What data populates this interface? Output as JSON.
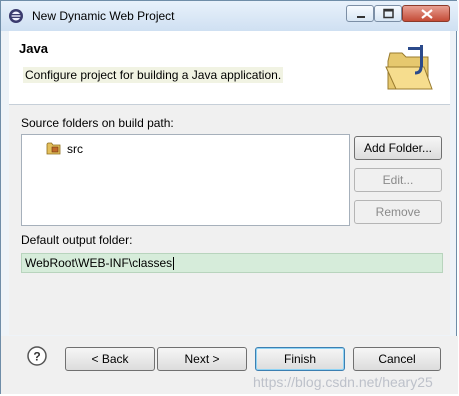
{
  "window": {
    "title": "New Dynamic Web Project"
  },
  "banner": {
    "title": "Java",
    "description": "Configure project for building a Java application."
  },
  "source_folders": {
    "label": "Source folders on build path:",
    "items": [
      {
        "label": "src"
      }
    ]
  },
  "buttons": {
    "add_folder": "Add Folder...",
    "edit": "Edit...",
    "remove": "Remove",
    "back": "< Back",
    "next": "Next >",
    "finish": "Finish",
    "cancel": "Cancel"
  },
  "output": {
    "label": "Default output folder:",
    "value": "WebRoot\\WEB-INF\\classes"
  },
  "watermark": "https://blog.csdn.net/heary25",
  "colors": {
    "title_bar": "#cfe0f2",
    "selected_field": "#d6ecda",
    "close_button": "#c44b36"
  }
}
